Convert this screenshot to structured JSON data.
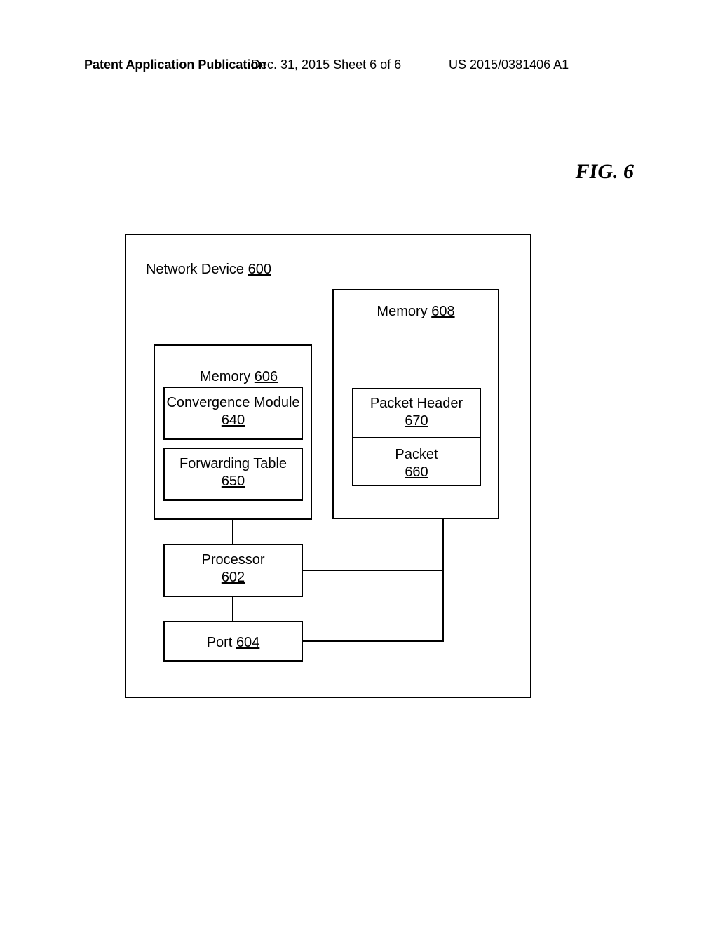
{
  "header": {
    "left": "Patent Application Publication",
    "center": "Dec. 31, 2015  Sheet 6 of 6",
    "right": "US 2015/0381406 A1"
  },
  "figure_label": "FIG. 6",
  "blocks": {
    "device_name": "Network Device",
    "device_ref": "600",
    "mem_left_name": "Memory",
    "mem_left_ref": "606",
    "conv_name": "Convergence Module",
    "conv_ref": "640",
    "fwd_name": "Forwarding Table",
    "fwd_ref": "650",
    "proc_name": "Processor",
    "proc_ref": "602",
    "port_name": "Port",
    "port_ref": "604",
    "mem_right_name": "Memory",
    "mem_right_ref": "608",
    "pkt_hdr_name": "Packet Header",
    "pkt_hdr_ref": "670",
    "pkt_name": "Packet",
    "pkt_ref": "660"
  }
}
